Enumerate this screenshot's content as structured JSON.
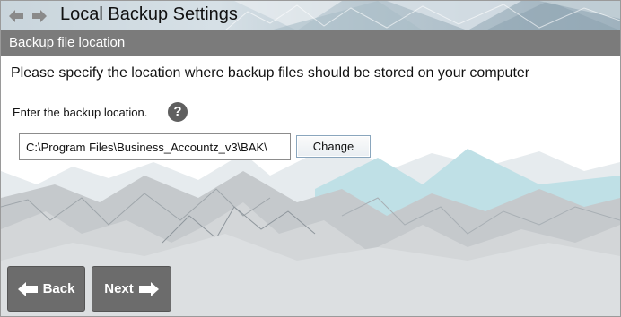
{
  "window": {
    "title": "Local Backup Settings"
  },
  "toolbar": {
    "back_icon": "arrow-left-icon",
    "forward_icon": "arrow-right-icon"
  },
  "section": {
    "title": "Backup file location"
  },
  "content": {
    "instruction": "Please specify the location where backup files should be stored on your computer",
    "field_label": "Enter the backup location.",
    "help_glyph": "?",
    "path_value": "C:\\Program Files\\Business_Accountz_v3\\BAK\\",
    "change_label": "Change"
  },
  "footer": {
    "back_label": "Back",
    "next_label": "Next"
  },
  "colors": {
    "section_bar": "#7b7b7b",
    "footer_button": "#6c6c6c",
    "help_icon": "#5f5f5f"
  }
}
